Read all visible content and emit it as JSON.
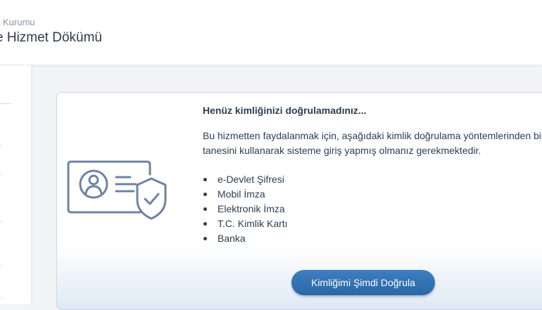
{
  "header": {
    "breadcrumb": "k Kurumu",
    "title": "e Hizmet Dökümü"
  },
  "card": {
    "title": "Henüz kimliğinizi doğrulamadınız...",
    "description": "Bu hizmetten faydalanmak için, aşağıdaki kimlik doğrulama yöntemlerinden bir tanesini kullanarak sisteme giriş yapmış olmanız gerekmektedir.",
    "methods": [
      "e-Devlet Şifresi",
      "Mobil İmza",
      "Elektronik İmza",
      "T.C. Kimlik Kartı",
      "Banka"
    ],
    "button_label": "Kimliğimi Şimdi Doğrula",
    "illustration_icon": "id-card-shield-icon"
  },
  "colors": {
    "accent": "#2f6fb0",
    "text": "#2c3e50",
    "icon": "#6d83a3"
  }
}
